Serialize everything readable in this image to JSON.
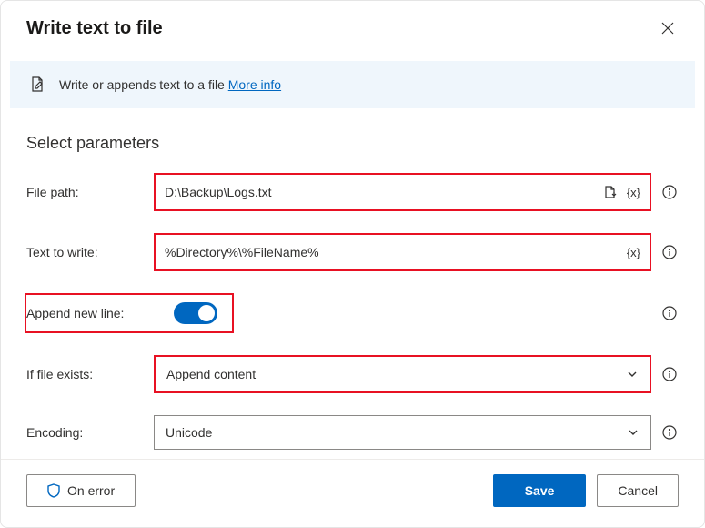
{
  "header": {
    "title": "Write text to file"
  },
  "banner": {
    "text": "Write or appends text to a file",
    "link": "More info"
  },
  "section": {
    "title": "Select parameters"
  },
  "fields": {
    "file_path": {
      "label": "File path:",
      "value": "D:\\Backup\\Logs.txt"
    },
    "text_to_write": {
      "label": "Text to write:",
      "value": "%Directory%\\%FileName%"
    },
    "append_new_line": {
      "label": "Append new line:",
      "value": true
    },
    "if_file_exists": {
      "label": "If file exists:",
      "value": "Append content"
    },
    "encoding": {
      "label": "Encoding:",
      "value": "Unicode"
    }
  },
  "footer": {
    "on_error": "On error",
    "save": "Save",
    "cancel": "Cancel"
  }
}
